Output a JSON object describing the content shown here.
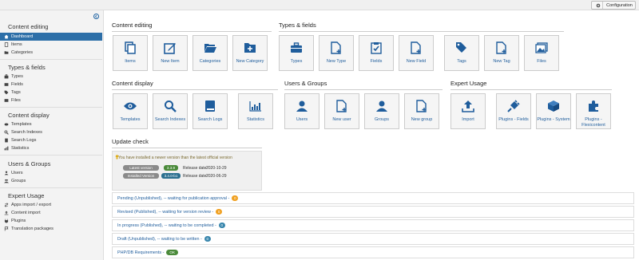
{
  "topbar": {
    "config_label": "Configuration"
  },
  "sidebar": {
    "sections": [
      {
        "title": "Content editing",
        "items": [
          "Dashboard",
          "Items",
          "Categories"
        ]
      },
      {
        "title": "Types & fields",
        "items": [
          "Types",
          "Fields",
          "Tags",
          "Files"
        ]
      },
      {
        "title": "Content display",
        "items": [
          "Templates",
          "Search Indexes",
          "Search Logs",
          "Statistics"
        ]
      },
      {
        "title": "Users & Groups",
        "items": [
          "Users",
          "Groups"
        ]
      },
      {
        "title": "Expert Usage",
        "items": [
          "Apps import / export",
          "Content import",
          "Plugins",
          "Translation packages"
        ]
      }
    ]
  },
  "main": {
    "content_editing": {
      "title": "Content editing",
      "tiles": [
        "Items",
        "New Item",
        "Categories",
        "New Category"
      ]
    },
    "types_fields": {
      "title": "Types & fields",
      "tiles": [
        "Types",
        "New Type",
        "Fields",
        "New Field",
        "Tags",
        "New Tag",
        "Files"
      ]
    },
    "content_display": {
      "title": "Content display",
      "tiles": [
        "Templates",
        "Search Indexes",
        "Search Logs",
        "Statistics"
      ]
    },
    "users_groups": {
      "title": "Users & Groups",
      "tiles": [
        "Users",
        "New user",
        "Groups",
        "New group"
      ]
    },
    "expert_usage": {
      "title": "Expert Usage",
      "tiles": [
        "Import",
        "Plugins - Fields",
        "Plugins - System",
        "Plugins - Flexicontent"
      ]
    },
    "update_check": {
      "title": "Update check",
      "message": "You have installed a newer version than the latest official version",
      "latest_label": "Latest version",
      "latest_version": "3.3.9",
      "latest_date_label": "Release date:",
      "latest_date": "2020-10-29",
      "installed_label": "Installed Version",
      "installed_version": "3.4.0-b1",
      "installed_date_label": "Release date:",
      "installed_date": "2020-06-29"
    },
    "notices": [
      {
        "text": "Pending (Unpublished), -- waiting for publication approval -",
        "count": "0",
        "color": "#f0a020"
      },
      {
        "text": "Revised (Published), -- waiting for version review -",
        "count": "0",
        "color": "#f0a020"
      },
      {
        "text": "In progress (Published), -- waiting to be completed -",
        "count": "0",
        "color": "#3a87ad"
      },
      {
        "text": "Draft (Unpublished), -- waiting to be written -",
        "count": "0",
        "color": "#3a87ad"
      },
      {
        "text": "PHP/DB Requirements -",
        "count": "OK",
        "color": "#4a8a3a"
      }
    ]
  },
  "colors": {
    "accent": "#2d6fa8",
    "tile_icon": "#1f5d9c",
    "ok": "#4a8a3a",
    "warning": "#f0a020",
    "info": "#3a87ad"
  }
}
